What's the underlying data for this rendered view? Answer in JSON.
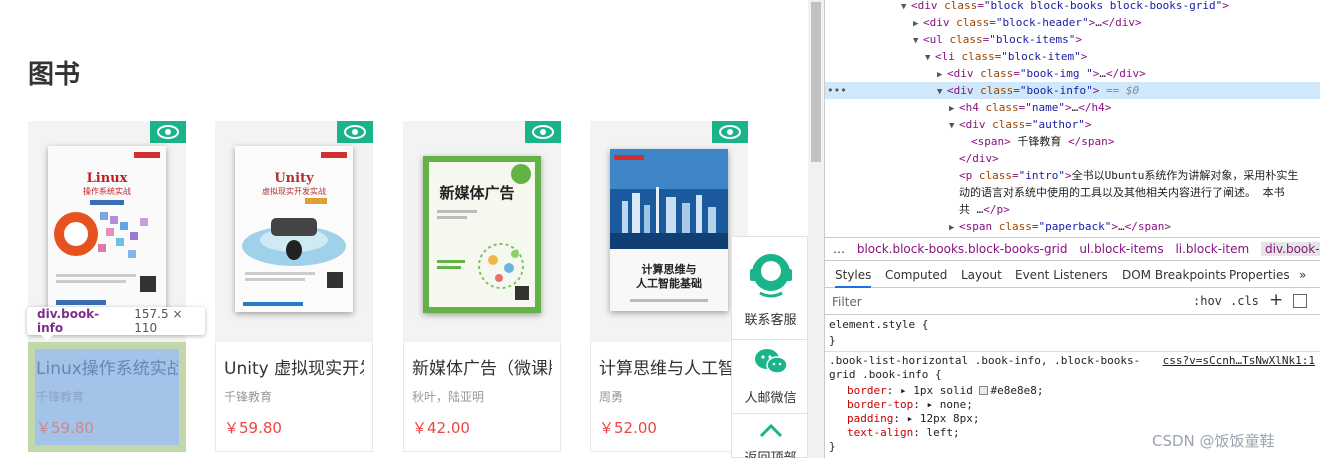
{
  "page": {
    "section_title": "图书",
    "books": [
      {
        "name": "Linux操作系统实战",
        "author": "千锋教育",
        "price": "￥59.80",
        "cover_title": "Linux",
        "cover_sub": "操作系统实战"
      },
      {
        "name": "Unity 虚拟现实开发实战",
        "author": "千锋教育",
        "price": "￥59.80",
        "cover_title": "Unity",
        "cover_sub": "虚拟现实开发实战"
      },
      {
        "name": "新媒体广告（微课版）",
        "author": "秋叶，陆亚明",
        "price": "￥42.00",
        "cover_title": "新媒体广告"
      },
      {
        "name": "计算思维与人工智能基础",
        "author": "周勇",
        "price": "￥52.00",
        "cover_title": "计算思维与\n人工智能基础"
      }
    ],
    "tooltip": {
      "name": "div.book-info",
      "size": "157.5 × 110"
    },
    "float_bar": {
      "service": "联系客服",
      "wechat": "人邮微信",
      "top": "返回顶部"
    }
  },
  "devtools": {
    "dom_lines": [
      {
        "indent": 6,
        "tri": "▼",
        "html": "<div class=\"block block-books block-books-grid\">"
      },
      {
        "indent": 7,
        "tri": "▶",
        "html": "<div class=\"block-header\">…</div>"
      },
      {
        "indent": 7,
        "tri": "▼",
        "html": "<ul class=\"block-items\">"
      },
      {
        "indent": 8,
        "tri": "▼",
        "html": "<li class=\"block-item\">"
      },
      {
        "indent": 9,
        "tri": "▶",
        "html": "<div class=\"book-img  \">…</div>"
      },
      {
        "indent": 9,
        "tri": "▼",
        "html": "<div class=\"book-info\"> == $0",
        "selected": true
      },
      {
        "indent": 10,
        "tri": "▶",
        "html": "<h4 class=\"name\">…</h4>"
      },
      {
        "indent": 10,
        "tri": "▼",
        "html": "<div class=\"author\">"
      },
      {
        "indent": 11,
        "tri": "",
        "html": "<span> 千锋教育 </span>"
      },
      {
        "indent": 10,
        "tri": "",
        "html": "</div>"
      },
      {
        "indent": 10,
        "tri": "",
        "html": "<p class=\"intro\">全书以Ubuntu系统作为讲解对象，采用朴实生"
      },
      {
        "indent": 10,
        "tri": "",
        "html": "动的语言对系统中使用的工具以及其他相关内容进行了阐述。 本书"
      },
      {
        "indent": 10,
        "tri": "",
        "html": "共 …</p>"
      },
      {
        "indent": 10,
        "tri": "▶",
        "html": "<span class=\"paperback\">…</span>"
      }
    ],
    "breadcrumbs": [
      "…",
      "block.block-books.block-books-grid",
      "ul.block-items",
      "li.block-item",
      "div.book-info"
    ],
    "tabs": [
      "Styles",
      "Computed",
      "Layout",
      "Event Listeners",
      "DOM Breakpoints",
      "Properties",
      "»"
    ],
    "filter": {
      "placeholder": "Filter",
      "hov": ":hov",
      "cls": ".cls",
      "plus": "+"
    },
    "rules": {
      "element_style": "element.style {",
      "close1": "}",
      "selector1": ".book-list-horizontal .book-info, .block-books-",
      "selector2": "grid .book-info {",
      "source": "css?v=sCcnh…TsNwXlNk1:1",
      "decls": [
        {
          "prop": "border",
          "val": "1px solid",
          "swatch": true,
          "val2": "#e8e8e8;"
        },
        {
          "prop": "border-top",
          "val": "none;"
        },
        {
          "prop": "padding",
          "val": "12px 8px;"
        },
        {
          "prop": "text-align",
          "val": "left;"
        }
      ],
      "close2": "}"
    }
  },
  "watermark": "CSDN @饭饭童鞋",
  "colors": {
    "accent": "#1bb38a",
    "price": "#ee4444",
    "highlight": "#a3c3e8"
  }
}
